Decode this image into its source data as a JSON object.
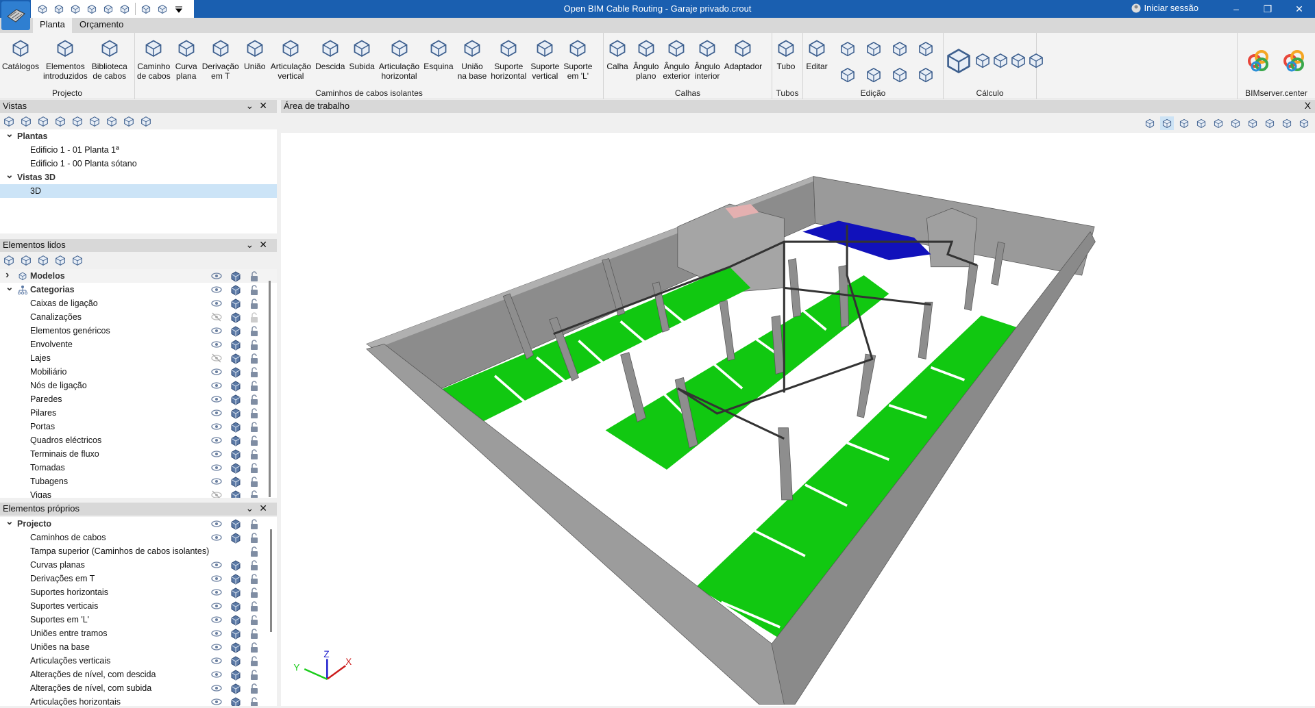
{
  "window": {
    "title": "Open BIM Cable Routing - Garaje privado.crout",
    "login_label": "Iniciar sessão",
    "controls": [
      "–",
      "❐",
      "✕"
    ],
    "quick_access": [
      "save-icon",
      "undo-icon",
      "redo-icon",
      "search-icon",
      "print-icon",
      "print-preview-icon",
      "sync-icon",
      "bimserver-share-icon",
      "customize-dropdown-icon"
    ]
  },
  "tabs": [
    {
      "label": "Planta",
      "active": true
    },
    {
      "label": "Orçamento",
      "active": false
    }
  ],
  "view_tools": [
    "zoom-previous-icon",
    "zoom-all-icon",
    "zoom-x2-icon",
    "redraw-icon",
    "zoom-window-icon",
    "pan-icon",
    "orbit-icon",
    "window-icon",
    "dxf-dwg-icon",
    "dxf-delete-icon",
    "magnet-icon",
    "ortho-icon",
    "grid-icon",
    "snap-icon",
    "keyboard-icon",
    "scale-icon",
    "dimension-icon",
    "angle-icon",
    "clock-icon",
    "layers-icon",
    "comment-icon",
    "tools-icon",
    "layout-icon",
    "globe-icon",
    "book-icon"
  ],
  "ribbon": {
    "groups": [
      {
        "label": "Projecto",
        "buttons": [
          "Catálogos",
          "Elementos\nintroduzidos",
          "Biblioteca\nde cabos"
        ]
      },
      {
        "label": "Caminhos de cabos isolantes",
        "buttons": [
          "Caminho\nde cabos",
          "Curva\nplana",
          "Derivação\nem T",
          "União",
          "Articulação\nvertical",
          "Descida",
          "Subida",
          "Articulação\nhorizontal",
          "Esquina",
          "União\nna base",
          "Suporte\nhorizontal",
          "Suporte\nvertical",
          "Suporte\nem 'L'"
        ]
      },
      {
        "label": "Calhas",
        "buttons": [
          "Calha",
          "Ângulo\nplano",
          "Ângulo\nexterior",
          "Ângulo\ninterior",
          "Adaptador"
        ]
      },
      {
        "label": "Tubos",
        "buttons": [
          "Tubo"
        ]
      },
      {
        "label": "Edição",
        "buttons": [
          "Editar"
        ]
      },
      {
        "label": "Cálculo",
        "buttons": []
      },
      {
        "label": "BIMserver.center",
        "buttons": []
      }
    ]
  },
  "panels": {
    "vistas": {
      "title": "Vistas",
      "tree": [
        {
          "label": "Plantas",
          "level": 0,
          "expanded": true
        },
        {
          "label": "Edificio 1 - 01 Planta 1ª",
          "level": 1
        },
        {
          "label": "Edificio 1 - 00 Planta sótano",
          "level": 1
        },
        {
          "label": "Vistas 3D",
          "level": 0,
          "expanded": true
        },
        {
          "label": "3D",
          "level": 1,
          "selected": true
        }
      ]
    },
    "elementos_lidos": {
      "title": "Elementos lidos",
      "rows": [
        {
          "label": "Modelos",
          "level": 0,
          "expanded": false,
          "eye": "visible",
          "lock": "normal"
        },
        {
          "label": "Categorias",
          "level": 0,
          "expanded": true,
          "eye": "visible",
          "lock": "normal"
        },
        {
          "label": "Caixas de ligação",
          "level": 1,
          "eye": "visible",
          "lock": "normal"
        },
        {
          "label": "Canalizações",
          "level": 1,
          "eye": "hidden",
          "lock": "faded"
        },
        {
          "label": "Elementos genéricos",
          "level": 1,
          "eye": "visible",
          "lock": "normal"
        },
        {
          "label": "Envolvente",
          "level": 1,
          "eye": "visible",
          "lock": "normal"
        },
        {
          "label": "Lajes",
          "level": 1,
          "eye": "hidden",
          "lock": "normal"
        },
        {
          "label": "Mobiliário",
          "level": 1,
          "eye": "visible",
          "lock": "normal"
        },
        {
          "label": "Nós de ligação",
          "level": 1,
          "eye": "visible",
          "lock": "normal"
        },
        {
          "label": "Paredes",
          "level": 1,
          "eye": "visible",
          "lock": "normal"
        },
        {
          "label": "Pilares",
          "level": 1,
          "eye": "visible",
          "lock": "normal"
        },
        {
          "label": "Portas",
          "level": 1,
          "eye": "visible",
          "lock": "normal"
        },
        {
          "label": "Quadros eléctricos",
          "level": 1,
          "eye": "visible",
          "lock": "normal"
        },
        {
          "label": "Terminais de fluxo",
          "level": 1,
          "eye": "visible",
          "lock": "normal"
        },
        {
          "label": "Tomadas",
          "level": 1,
          "eye": "visible",
          "lock": "normal"
        },
        {
          "label": "Tubagens",
          "level": 1,
          "eye": "visible",
          "lock": "normal"
        },
        {
          "label": "Vigas",
          "level": 1,
          "eye": "hidden",
          "lock": "normal"
        }
      ]
    },
    "elementos_proprios": {
      "title": "Elementos próprios",
      "rows": [
        {
          "label": "Projecto",
          "level": 0,
          "expanded": true,
          "eye": "visible",
          "lock": "normal"
        },
        {
          "label": "Caminhos de cabos",
          "level": 1,
          "eye": "visible",
          "lock": "normal"
        },
        {
          "label": "Tampa superior (Caminhos de cabos isolantes)",
          "level": 1,
          "eye": null,
          "lock": "normal"
        },
        {
          "label": "Curvas planas",
          "level": 1,
          "eye": "visible",
          "lock": "normal"
        },
        {
          "label": "Derivações em T",
          "level": 1,
          "eye": "visible",
          "lock": "normal"
        },
        {
          "label": "Suportes horizontais",
          "level": 1,
          "eye": "visible",
          "lock": "normal"
        },
        {
          "label": "Suportes verticais",
          "level": 1,
          "eye": "visible",
          "lock": "normal"
        },
        {
          "label": "Suportes em 'L'",
          "level": 1,
          "eye": "visible",
          "lock": "normal"
        },
        {
          "label": "Uniões entre tramos",
          "level": 1,
          "eye": "visible",
          "lock": "normal"
        },
        {
          "label": "Uniões na base",
          "level": 1,
          "eye": "visible",
          "lock": "normal"
        },
        {
          "label": "Articulações verticais",
          "level": 1,
          "eye": "visible",
          "lock": "normal"
        },
        {
          "label": "Alterações de nível, com descida",
          "level": 1,
          "eye": "visible",
          "lock": "normal"
        },
        {
          "label": "Alterações de nível, com subida",
          "level": 1,
          "eye": "visible",
          "lock": "normal"
        },
        {
          "label": "Articulações horizontais",
          "level": 1,
          "eye": "visible",
          "lock": "normal"
        }
      ]
    }
  },
  "workspace": {
    "title": "Área de trabalho",
    "close": "X",
    "axes": {
      "x": "X",
      "y": "Y",
      "z": "Z"
    },
    "toolbar": [
      "axes-icon",
      "shield-view-icon",
      "hide-icon",
      "orbit-center-icon",
      "section-red-icon",
      "section-green-icon",
      "section-blue-icon",
      "render-icon",
      "visibility-icon",
      "3d-view-icon"
    ]
  },
  "colors": {
    "titlebar": "#1a5fb0",
    "icon": "#3d5f8e",
    "parking": "#11c811",
    "wall": "#9a9a9a",
    "selection": "#cce4f7"
  }
}
